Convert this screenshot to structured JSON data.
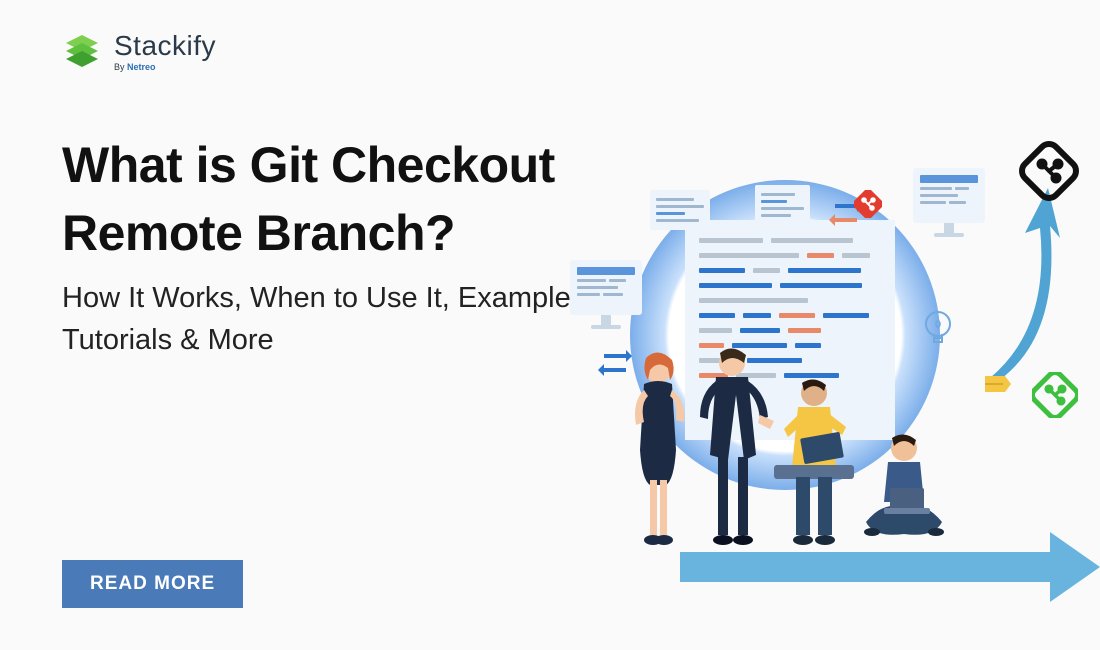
{
  "brand": {
    "name": "Stackify",
    "byline_prefix": "By ",
    "byline_company": "Netreo"
  },
  "headline": "What is Git Checkout Remote Branch?",
  "subhead": "How It Works, When to Use It, Examples, Tutorials & More",
  "cta": {
    "label": "READ MORE"
  },
  "icons": {
    "git_black": "git-icon",
    "git_red": "git-icon",
    "git_green": "git-icon",
    "lightbulb": "lightbulb-icon"
  },
  "colors": {
    "brand_green": "#5fbf3f",
    "brand_dark": "#2a3a4a",
    "cta_blue": "#4a7ab8",
    "accent_blue": "#2d74cc",
    "accent_orange": "#e8896a",
    "git_red": "#e33b2e",
    "git_green": "#3fbf3f",
    "arrow_blue": "#58a8d8"
  }
}
